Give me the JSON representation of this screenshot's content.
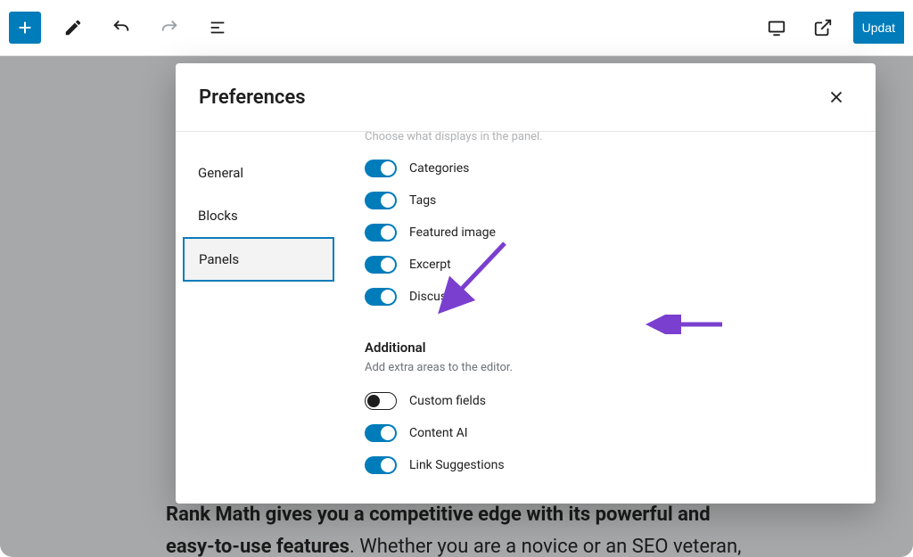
{
  "toolbar": {
    "update_label": "Updat"
  },
  "modal": {
    "title": "Preferences",
    "tabs": {
      "general": "General",
      "blocks": "Blocks",
      "panels": "Panels"
    },
    "hint_cut": "Choose what displays in the panel.",
    "rows": {
      "categories": "Categories",
      "tags": "Tags",
      "featured": "Featured image",
      "excerpt": "Excerpt",
      "discussion": "Discussion"
    },
    "additional": {
      "title": "Additional",
      "sub": "Add extra areas to the editor.",
      "custom_fields": "Custom fields",
      "content_ai": "Content AI",
      "link_suggestions": "Link Suggestions"
    }
  },
  "bg": {
    "line1a": "Rank Math gives you a competitive edge with its powerful and",
    "line2a": "easy-to-use features",
    "line2b": ". Whether you are a novice or an SEO veteran,"
  }
}
